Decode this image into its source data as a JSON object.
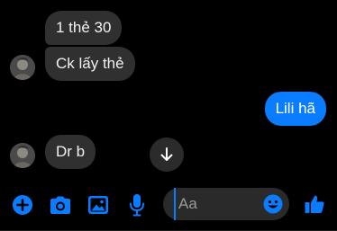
{
  "messages": [
    {
      "text": "1 thẻ 30",
      "direction": "incoming"
    },
    {
      "text": "Ck lấy thẻ",
      "direction": "incoming"
    },
    {
      "text": "Lili hã",
      "direction": "outgoing"
    },
    {
      "text": "Dr b",
      "direction": "incoming"
    }
  ],
  "composer": {
    "placeholder": "Aa"
  },
  "icons": {
    "add": "plus-circle-icon",
    "camera": "camera-icon",
    "gallery": "image-icon",
    "voice": "microphone-icon",
    "emoji": "emoji-icon",
    "like": "thumbs-up-icon",
    "scroll": "arrow-down-icon"
  },
  "colors": {
    "background": "#000000",
    "incoming_bubble": "#303030",
    "outgoing_bubble": "#0a7cff",
    "accent": "#0a7cff"
  }
}
